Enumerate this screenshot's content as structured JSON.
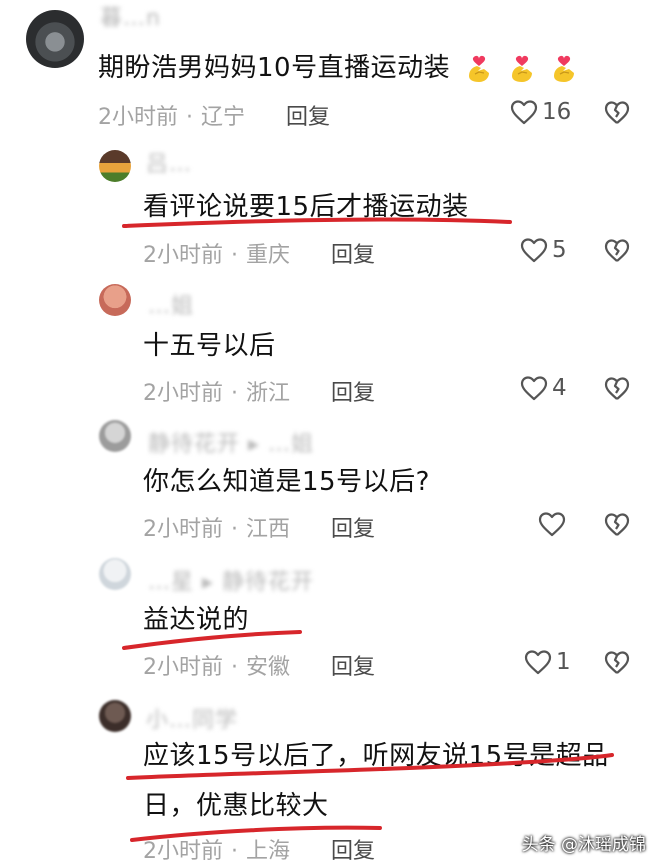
{
  "comments": [
    {
      "name": "暮…n",
      "text": "期盼浩男妈妈10号直播运动装",
      "emojis": [
        "finger-heart",
        "finger-heart",
        "finger-heart"
      ],
      "time": "2小时前",
      "region": "辽宁",
      "reply_label": "回复",
      "likes": "16"
    },
    {
      "name": "吕…",
      "text": "看评论说要15后才播运动装",
      "time": "2小时前",
      "region": "重庆",
      "reply_label": "回复",
      "likes": "5"
    },
    {
      "name": "…姐",
      "text": "十五号以后",
      "time": "2小时前",
      "region": "浙江",
      "reply_label": "回复",
      "likes": "4"
    },
    {
      "name": "静待花开 ▸ …姐",
      "text": "你怎么知道是15号以后?",
      "time": "2小时前",
      "region": "江西",
      "reply_label": "回复",
      "likes": ""
    },
    {
      "name": "…星 ▸ 静待花开",
      "text": "益达说的",
      "time": "2小时前",
      "region": "安徽",
      "reply_label": "回复",
      "likes": "1"
    },
    {
      "name": "小…同学",
      "text_line1": "应该15号以后了，听网友说15号是超品",
      "text_line2": "日，优惠比较大",
      "time": "2小时前",
      "region": "上海",
      "reply_label": "回复",
      "likes": ""
    }
  ],
  "separator": "·",
  "watermark": "头条 @沐瑶成锦",
  "colors": {
    "underline": "#d7262b",
    "meta": "#a3a3a3",
    "text": "#111111"
  }
}
